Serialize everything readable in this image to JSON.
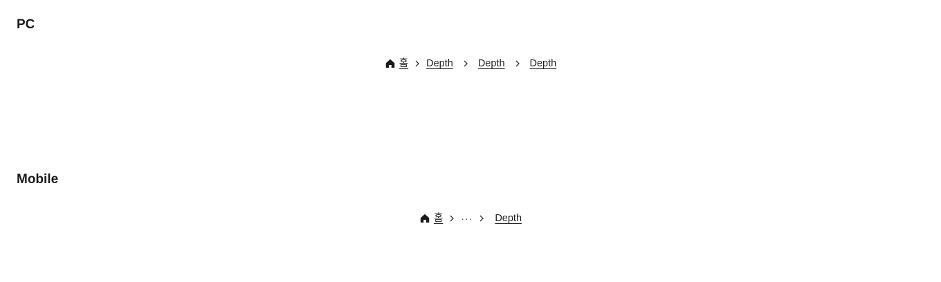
{
  "sections": {
    "pc": {
      "title": "PC",
      "breadcrumb": {
        "home_label": "홈",
        "items": [
          "Depth",
          "Depth",
          "Depth"
        ]
      }
    },
    "mobile": {
      "title": "Mobile",
      "breadcrumb": {
        "home_label": "홈",
        "ellipsis": "···",
        "items": [
          "Depth"
        ]
      }
    }
  },
  "icons": {
    "home": "home-icon",
    "separator": "chevron-right-icon"
  },
  "colors": {
    "text": "#1e1e1e",
    "background": "#ffffff"
  }
}
